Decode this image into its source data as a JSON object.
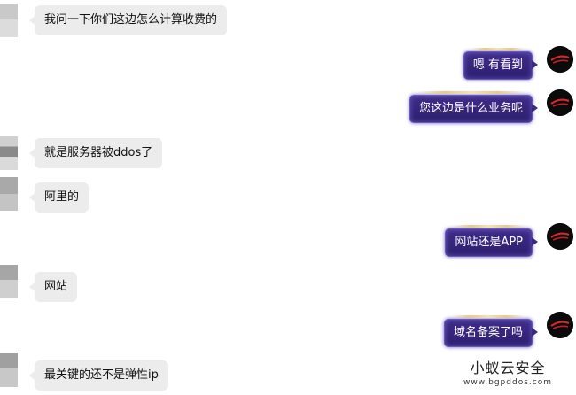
{
  "messages": [
    {
      "side": "left",
      "text": "我问一下你们这边怎么计算收费的"
    },
    {
      "side": "right",
      "text": "嗯 有看到"
    },
    {
      "side": "right",
      "text": "您这边是什么业务呢"
    },
    {
      "side": "left",
      "text": "就是服务器被ddos了"
    },
    {
      "side": "left",
      "text": "阿里的"
    },
    {
      "side": "right",
      "text": "网站还是APP"
    },
    {
      "side": "left",
      "text": "网站"
    },
    {
      "side": "right",
      "text": "域名备案了吗"
    },
    {
      "side": "left",
      "text": "最关键的还不是弹性ip"
    }
  ],
  "watermark": {
    "title": "小蚁云安全",
    "url": "www.bgpddos.com"
  }
}
